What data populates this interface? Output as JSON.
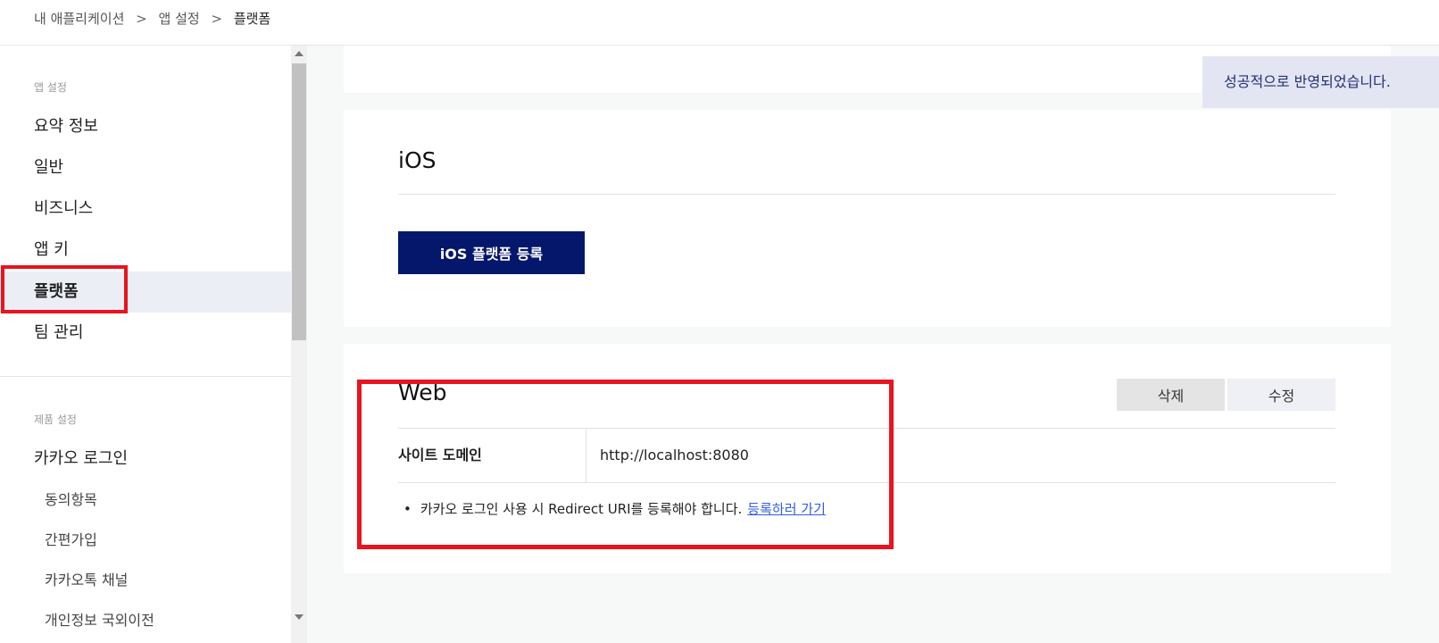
{
  "breadcrumb": {
    "items": [
      "내 애플리케이션",
      "앱 설정",
      "플랫폼"
    ],
    "separator": ">"
  },
  "sidebar": {
    "section_app": "앱 설정",
    "items": [
      "요약 정보",
      "일반",
      "비즈니스",
      "앱 키",
      "플랫폼",
      "팀 관리"
    ],
    "active": "플랫폼",
    "section_product": "제품 설정",
    "product_items": [
      "카카오 로그인"
    ],
    "sub_items": [
      "동의항목",
      "간편가입",
      "카카오톡 채널",
      "개인정보 국외이전"
    ]
  },
  "ios": {
    "title": "iOS",
    "register_button": "iOS 플랫폼 등록"
  },
  "web": {
    "title": "Web",
    "delete_button": "삭제",
    "edit_button": "수정",
    "site_domain_label": "사이트 도메인",
    "site_domain_value": "http://localhost:8080",
    "note_bullet": "•",
    "note_text": "카카오 로그인 사용 시 Redirect URI를 등록해야 합니다.",
    "note_link": "등록하러 가기"
  },
  "toast": {
    "message": "성공적으로 반영되었습니다."
  },
  "colors": {
    "primary": "#04176b",
    "highlight": "#e8141f",
    "active_bg": "#eceef6",
    "link": "#2f5fe0"
  }
}
